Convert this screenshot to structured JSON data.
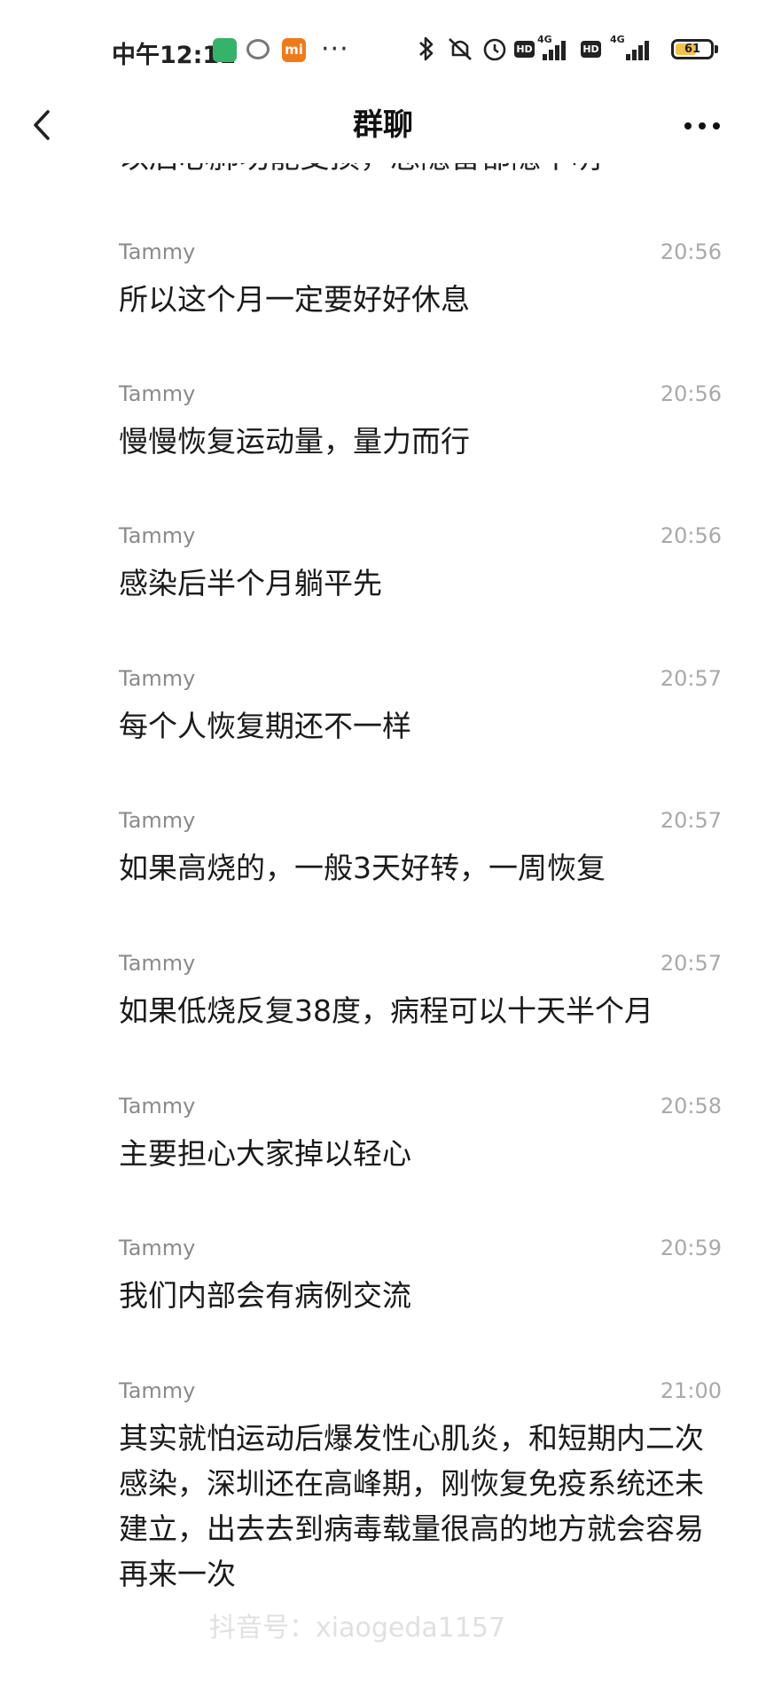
{
  "status_bar": {
    "time": "中午12:11",
    "mi_label": "mi",
    "more_dots": "···",
    "hd_label": "HD",
    "network": "4G",
    "battery": "61",
    "battery_level": 0.61,
    "icons": [
      "phone-app-icon",
      "chat-app-icon",
      "mi-app-icon",
      "bluetooth-icon",
      "mute-icon",
      "alarm-icon",
      "hd-icon",
      "signal-icon",
      "battery-icon"
    ]
  },
  "header": {
    "title": "群聊",
    "back_icon": "chevron-left-icon",
    "more_icon": "more-dots-icon"
  },
  "partial_line": "以后心肺功能受损，总隐留都隐不明",
  "messages": [
    {
      "sender": "Tammy",
      "time": "20:56",
      "text": "所以这个月一定要好好休息"
    },
    {
      "sender": "Tammy",
      "time": "20:56",
      "text": "慢慢恢复运动量，量力而行"
    },
    {
      "sender": "Tammy",
      "time": "20:56",
      "text": "感染后半个月躺平先"
    },
    {
      "sender": "Tammy",
      "time": "20:57",
      "text": "每个人恢复期还不一样"
    },
    {
      "sender": "Tammy",
      "time": "20:57",
      "text": "如果高烧的，一般3天好转，一周恢复"
    },
    {
      "sender": "Tammy",
      "time": "20:57",
      "text": "如果低烧反复38度，病程可以十天半个月"
    },
    {
      "sender": "Tammy",
      "time": "20:58",
      "text": "主要担心大家掉以轻心"
    },
    {
      "sender": "Tammy",
      "time": "20:59",
      "text": "我们内部会有病例交流"
    },
    {
      "sender": "Tammy",
      "time": "21:00",
      "text": "其实就怕运动后爆发性心肌炎，和短期内二次感染，深圳还在高峰期，刚恢复免疫系统还未建立，出去去到病毒载量很高的地方就会容易再来一次"
    }
  ],
  "watermark": "抖音号：xiaogeda1157"
}
